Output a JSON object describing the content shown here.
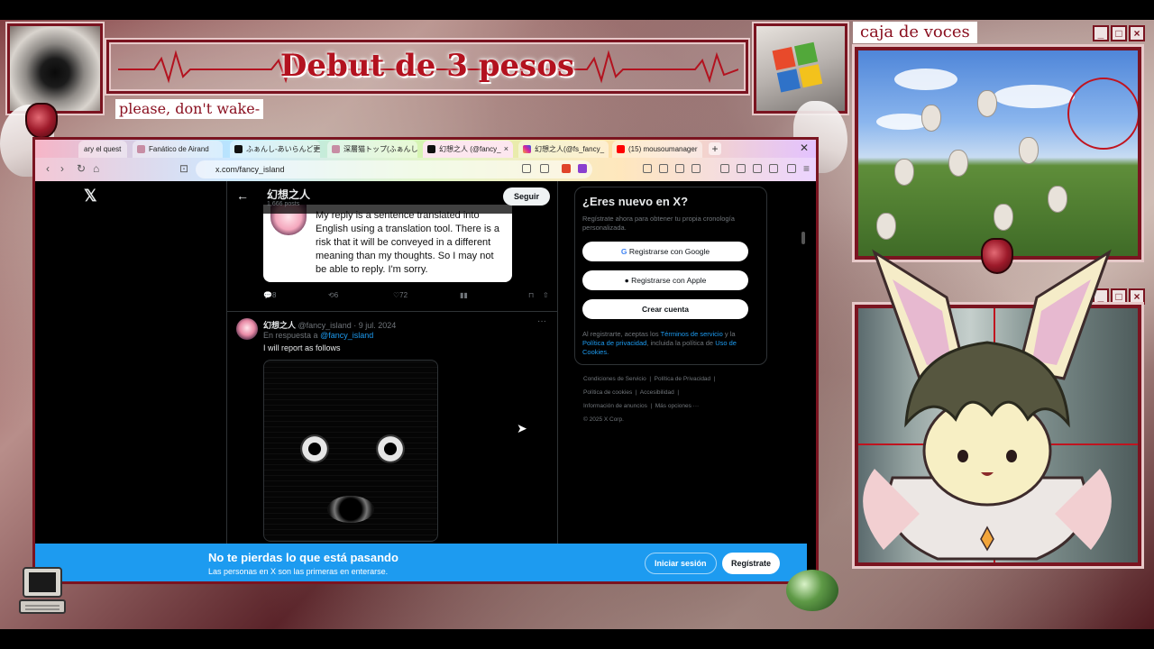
{
  "overlay": {
    "title": "Debut de 3 pesos",
    "subtitle": "please, don't wake-",
    "voice_box_label": "caja de voces"
  },
  "browser": {
    "tabs": [
      {
        "label": "ary el quest",
        "icon": "generic-icon",
        "active": false
      },
      {
        "label": "Fanático de Airand",
        "icon": "avatar-icon",
        "active": false
      },
      {
        "label": "ふぁんし-あいらんど更新",
        "icon": "x-icon",
        "active": false
      },
      {
        "label": "深層猫トップ(ふぁんし-あ",
        "icon": "avatar-icon",
        "active": false
      },
      {
        "label": "幻想之人 (@fancy_",
        "icon": "x-icon",
        "active": true
      },
      {
        "label": "幻想之人(@fs_fancy_",
        "icon": "instagram-icon",
        "active": false
      },
      {
        "label": "(15) mousoumanager",
        "icon": "youtube-icon",
        "active": false
      }
    ],
    "url": "x.com/fancy_island"
  },
  "x_page": {
    "profile_name": "幻想之人",
    "post_count": "1,666 posts",
    "follow_label": "Seguir",
    "bubble_text": "My reply is a sentence translated into English using a translation tool. There is a risk that it will be conveyed in a different meaning than my thoughts. So I may not be able to reply. I'm sorry.",
    "actions": {
      "replies": "8",
      "reposts": "6",
      "likes": "72"
    },
    "post": {
      "author": "幻想之人",
      "handle": "@fancy_island",
      "date": "· 9 jul. 2024",
      "reply_prefix": "En respuesta a",
      "reply_handle": "@fancy_island",
      "text": "I will report as follows"
    },
    "sidebar": {
      "title": "¿Eres nuevo en X?",
      "desc": "Regístrate ahora para obtener tu propia cronología personalizada.",
      "google": "Registrarse con Google",
      "apple": "Registrarse con Apple",
      "create": "Crear cuenta",
      "terms_a": "Al registrarte, aceptas los",
      "terms_link1": "Términos de servicio",
      "terms_b": "y la",
      "terms_link2": "Política de privacidad",
      "terms_c": ", incluida la política de",
      "terms_link3": "Uso de Cookies."
    },
    "footer": {
      "l1": "Condiciones de Servicio",
      "l2": "Política de Privacidad",
      "l3": "Política de cookies",
      "l4": "Accesibilidad",
      "l5": "Información de anuncios",
      "l6": "Más opciones ···",
      "l7": "© 2025 X Corp."
    },
    "banner": {
      "title": "No te pierdas lo que está pasando",
      "subtitle": "Las personas en X son las primeras en enterarse.",
      "login": "Iniciar sesión",
      "signup": "Regístrate"
    }
  },
  "colors": {
    "accent_red": "#b3121f",
    "frame_red": "#7a1420",
    "x_blue": "#1d9bf0"
  }
}
